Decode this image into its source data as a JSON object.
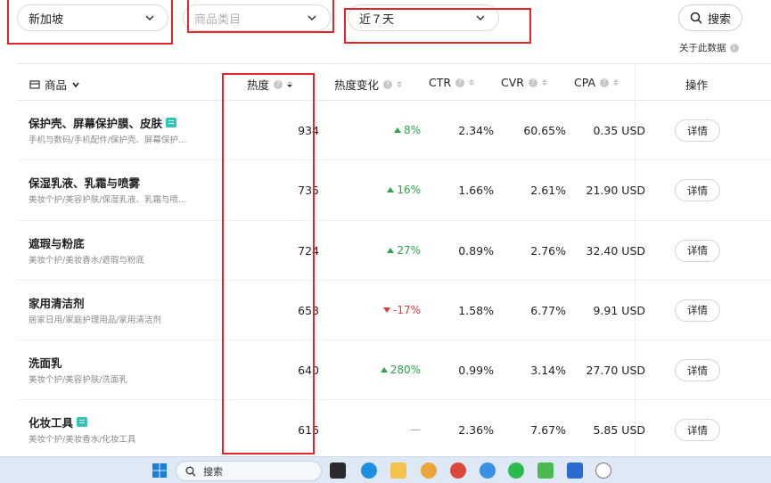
{
  "filters": {
    "region": "新加坡",
    "category_placeholder": "商品类目",
    "date_range": "近７天"
  },
  "search": {
    "label": "搜索",
    "icon": "search-icon"
  },
  "about_data": "关于此数据",
  "columns": {
    "product": "商品",
    "heat": "热度",
    "heat_change": "热度变化",
    "ctr": "CTR",
    "cvr": "CVR",
    "cpa": "CPA",
    "action": "操作"
  },
  "rows": [
    {
      "name": "保护壳、屏幕保护膜、皮肤",
      "tag": true,
      "path": "手机与数码/手机配件/保护壳、屏幕保护…",
      "heat": "934",
      "change": "8%",
      "dir": "up",
      "ctr": "2.34%",
      "cvr": "60.65%",
      "cpa": "0.35 USD",
      "action": "详情"
    },
    {
      "name": "保湿乳液、乳霜与喷雾",
      "tag": false,
      "path": "美妆个护/美容护肤/保湿乳液、乳霜与喷…",
      "heat": "735",
      "change": "16%",
      "dir": "up",
      "ctr": "1.66%",
      "cvr": "2.61%",
      "cpa": "21.90 USD",
      "action": "详情"
    },
    {
      "name": "遮瑕与粉底",
      "tag": false,
      "path": "美妆个护/美妆香水/遮瑕与粉底",
      "heat": "724",
      "change": "27%",
      "dir": "up",
      "ctr": "0.89%",
      "cvr": "2.76%",
      "cpa": "32.40 USD",
      "action": "详情"
    },
    {
      "name": "家用清洁剂",
      "tag": false,
      "path": "居家日用/家庭护理用品/家用清洁剂",
      "heat": "658",
      "change": "-17%",
      "dir": "down",
      "ctr": "1.58%",
      "cvr": "6.77%",
      "cpa": "9.91 USD",
      "action": "详情"
    },
    {
      "name": "洗面乳",
      "tag": false,
      "path": "美妆个护/美容护肤/洗面乳",
      "heat": "640",
      "change": "280%",
      "dir": "up",
      "ctr": "0.99%",
      "cvr": "3.14%",
      "cpa": "27.70 USD",
      "action": "详情"
    },
    {
      "name": "化妆工具",
      "tag": true,
      "path": "美妆个护/美妆香水/化妆工具",
      "heat": "616",
      "change": "—",
      "dir": "flat",
      "ctr": "2.36%",
      "cvr": "7.67%",
      "cpa": "5.85 USD",
      "action": "详情"
    }
  ],
  "taskbar": {
    "search_label": "搜索"
  },
  "colors": {
    "highlight_box": "#e4262a",
    "up": "#2fa24a",
    "down": "#e23b3b",
    "tag": "#2cc7b8"
  }
}
